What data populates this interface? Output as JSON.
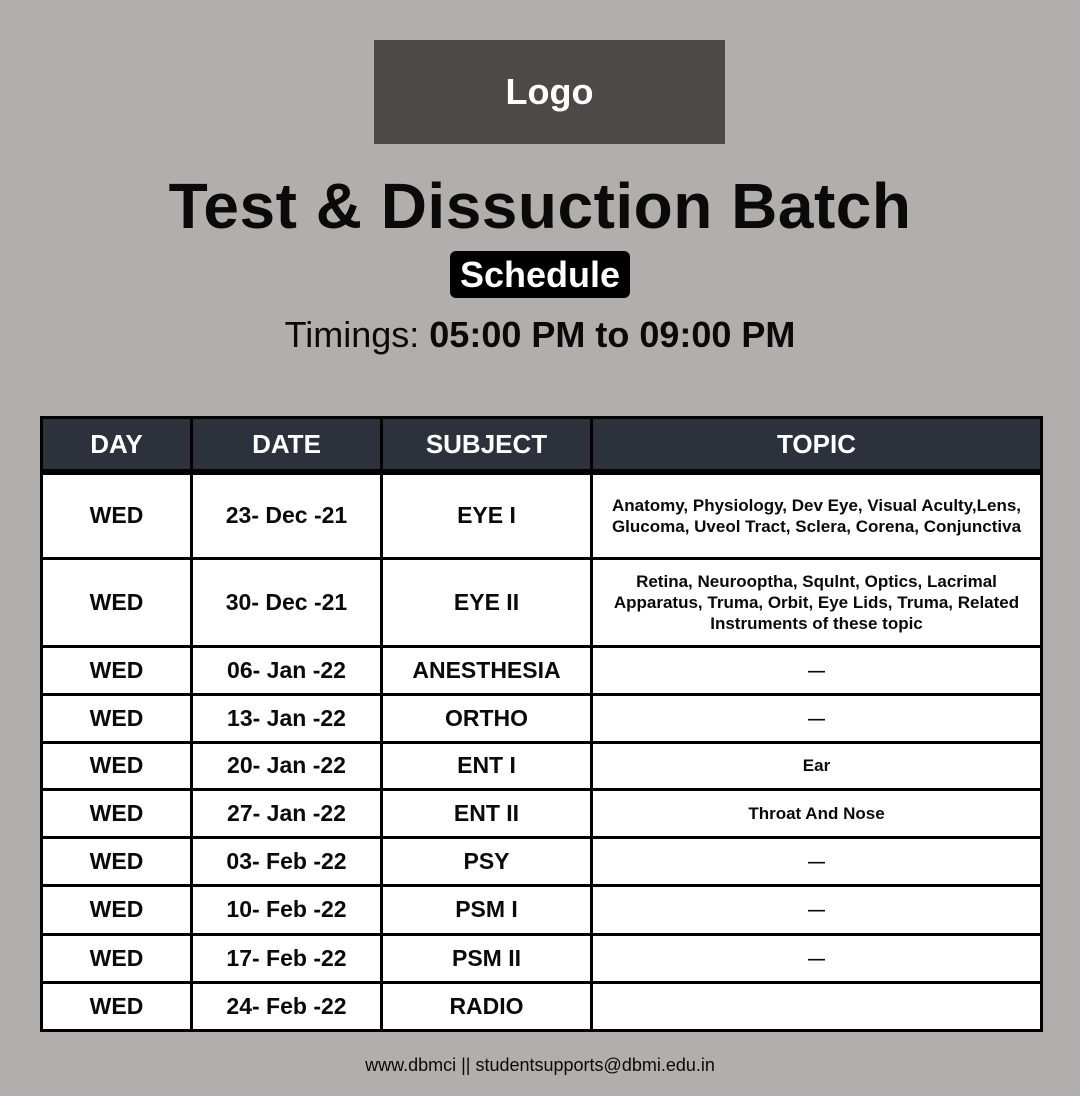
{
  "logo": {
    "text": "Logo"
  },
  "title": "Test & Dissuction Batch",
  "badge": "Schedule",
  "timings": {
    "label": "Timings:",
    "value": "05:00 PM to 09:00 PM"
  },
  "table": {
    "headers": [
      "DAY",
      "DATE",
      "SUBJECT",
      "TOPIC"
    ],
    "rows": [
      {
        "day": "WED",
        "date": "23- Dec -21",
        "subject": "EYE I",
        "topic": "Anatomy, Physiology, Dev Eye, Visual Aculty,Lens, Glucoma, Uveol Tract, Sclera, Corena, Conjunctiva"
      },
      {
        "day": "WED",
        "date": "30- Dec -21",
        "subject": "EYE II",
        "topic": "Retina, Neurooptha, Squlnt, Optics, Lacrimal Apparatus, Truma, Orbit, Eye Lids, Truma, Related Instruments of these topic"
      },
      {
        "day": "WED",
        "date": "06- Jan -22",
        "subject": "ANESTHESIA",
        "topic": "—"
      },
      {
        "day": "WED",
        "date": "13- Jan -22",
        "subject": "ORTHO",
        "topic": "—"
      },
      {
        "day": "WED",
        "date": "20- Jan -22",
        "subject": "ENT I",
        "topic": "Ear"
      },
      {
        "day": "WED",
        "date": "27- Jan -22",
        "subject": "ENT II",
        "topic": "Throat And Nose"
      },
      {
        "day": "WED",
        "date": "03- Feb -22",
        "subject": "PSY",
        "topic": "—"
      },
      {
        "day": "WED",
        "date": "10- Feb -22",
        "subject": "PSM I",
        "topic": "—"
      },
      {
        "day": "WED",
        "date": "17- Feb -22",
        "subject": "PSM II",
        "topic": "—"
      },
      {
        "day": "WED",
        "date": "24- Feb -22",
        "subject": "RADIO",
        "topic": ""
      }
    ]
  },
  "footer": "www.dbmci  || studentsupports@dbmi.edu.in"
}
